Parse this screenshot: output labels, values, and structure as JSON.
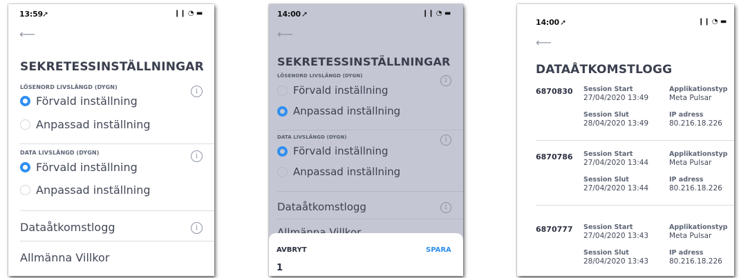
{
  "screen1": {
    "status_time": "13:59",
    "status_icons": "❙❙ ◔ ▬",
    "back_icon": "arrow-left-icon",
    "title": "SEKRETESSINSTÄLLNINGAR",
    "password_section": "LÖSENORD LIVSLÄNGD (DYGN)",
    "password_options": [
      "Förvald inställning",
      "Anpassad inställning"
    ],
    "data_section": "DATA LIVSLÄNGD (DYGN)",
    "data_options": [
      "Förvald inställning",
      "Anpassad inställning"
    ],
    "access_log_label": "Dataåtkomstlogg",
    "terms_label": "Allmänna Villkor",
    "info_glyph": "i"
  },
  "screen2": {
    "status_time": "14:00",
    "status_icons": "❙❙ ◔ ▬",
    "title": "SEKRETESSINSTÄLLNINGAR",
    "password_section": "LÖSENORD LIVSLÄNGD (DYGN)",
    "password_options": [
      "Förvald inställning",
      "Anpassad inställning"
    ],
    "data_section": "DATA LIVSLÄNGD (DYGN)",
    "data_options": [
      "Förvald inställning",
      "Anpassad inställning"
    ],
    "access_log_label": "Dataåtkomstlogg",
    "terms_label": "Allmänna Villkor",
    "info_glyph": "i",
    "sheet": {
      "cancel_label": "AVBRYT",
      "save_label": "SPARA",
      "value": "1"
    }
  },
  "screen3": {
    "status_time": "14:00",
    "status_icons": "❙❙ ◔ ▬",
    "title": "DATAÅTKOMSTLOGG",
    "labels": {
      "session_start": "Session Start",
      "session_end": "Session Slut",
      "app_type": "Applikationstyp",
      "ip": "IP adress"
    },
    "entries": [
      {
        "id": "6870830",
        "start": "27/04/2020 13:49",
        "app": "Meta Pulsar",
        "end": "28/04/2020 13:49",
        "ip": "80.216.18.226"
      },
      {
        "id": "6870786",
        "start": "27/04/2020 13:44",
        "app": "Meta Pulsar",
        "end": "27/04/2020 13:44",
        "ip": "80.216.18.226"
      },
      {
        "id": "6870777",
        "start": "27/04/2020 13:43",
        "app": "Meta Pulsar",
        "end": "28/04/2020 13:43",
        "ip": "80.216.18.226"
      }
    ]
  },
  "colors": {
    "accent": "#2f8ff0",
    "dim_overlay": "#c4c7d3",
    "text": "#434858"
  }
}
